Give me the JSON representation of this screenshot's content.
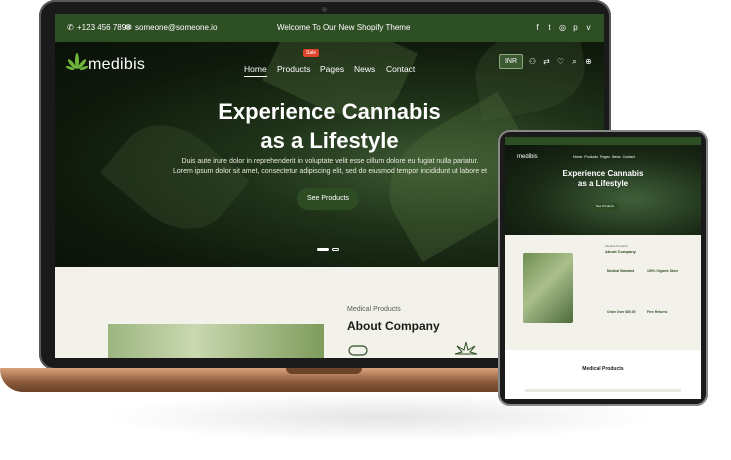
{
  "site": {
    "topbar": {
      "phone": "+123 456 7890",
      "email": "someone@someone.io",
      "announcement": "Welcome To Our New Shopify Theme"
    },
    "logo": "medibis",
    "nav": [
      "Home",
      "Products",
      "Pages",
      "News",
      "Contact"
    ],
    "sale_badge": "Sale",
    "currency": "INR",
    "hero": {
      "title_line1": "Experience Cannabis",
      "title_line2": "as a Lifestyle",
      "desc_line1": "Duis aute irure dolor in reprehenderit in voluptate velit esse cillum dolore eu fugiat nulla pariatur.",
      "desc_line2": "Lorem ipsum dolor sit amet, consectetur adipiscing elit, sed do eiusmod tempor incididunt ut labore et",
      "button": "See Products"
    },
    "about": {
      "kicker": "Medical Products",
      "title": "About Company"
    }
  },
  "tablet": {
    "logo": "medibis",
    "hero_title_line1": "Experience Cannabis",
    "hero_title_line2": "as a Lifestyle",
    "button": "See Products",
    "about_kicker": "Medical Products",
    "about_title": "About Company",
    "features": [
      "Medical Standard",
      "100% Organic Store",
      "Order Over $60.00",
      "Free Returns"
    ],
    "section_title": "Medical Products"
  },
  "colors": {
    "brand_green": "#2e4e24",
    "cream": "#f3f2ea",
    "sale_red": "#e0452b"
  }
}
